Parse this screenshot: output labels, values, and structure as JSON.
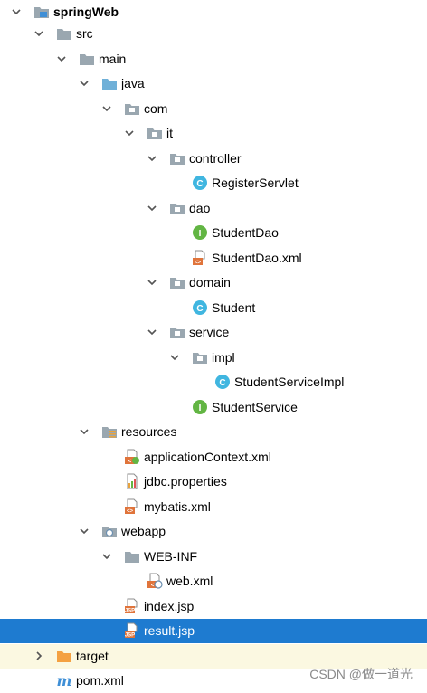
{
  "tree": [
    {
      "label": "springWeb",
      "icon": "module-folder-icon",
      "arrow": "down",
      "bold": true
    },
    {
      "label": "src",
      "icon": "folder-icon",
      "arrow": "down"
    },
    {
      "label": "main",
      "icon": "folder-icon",
      "arrow": "down"
    },
    {
      "label": "java",
      "icon": "source-root-folder-icon",
      "arrow": "down"
    },
    {
      "label": "com",
      "icon": "package-icon",
      "arrow": "down"
    },
    {
      "label": "it",
      "icon": "package-icon",
      "arrow": "down"
    },
    {
      "label": "controller",
      "icon": "package-icon",
      "arrow": "down"
    },
    {
      "label": "RegisterServlet",
      "icon": "java-class-icon",
      "arrow": "none"
    },
    {
      "label": "dao",
      "icon": "package-icon",
      "arrow": "down"
    },
    {
      "label": "StudentDao",
      "icon": "java-interface-icon",
      "arrow": "none"
    },
    {
      "label": "StudentDao.xml",
      "icon": "xml-file-icon",
      "arrow": "none"
    },
    {
      "label": "domain",
      "icon": "package-icon",
      "arrow": "down"
    },
    {
      "label": "Student",
      "icon": "java-class-icon",
      "arrow": "none"
    },
    {
      "label": "service",
      "icon": "package-icon",
      "arrow": "down"
    },
    {
      "label": "impl",
      "icon": "package-icon",
      "arrow": "down"
    },
    {
      "label": "StudentServiceImpl",
      "icon": "java-class-icon",
      "arrow": "none"
    },
    {
      "label": "StudentService",
      "icon": "java-interface-icon",
      "arrow": "none"
    },
    {
      "label": "resources",
      "icon": "resources-folder-icon",
      "arrow": "down"
    },
    {
      "label": "applicationContext.xml",
      "icon": "spring-xml-icon",
      "arrow": "none"
    },
    {
      "label": "jdbc.properties",
      "icon": "properties-file-icon",
      "arrow": "none"
    },
    {
      "label": "mybatis.xml",
      "icon": "xml-file-icon",
      "arrow": "none"
    },
    {
      "label": "webapp",
      "icon": "web-folder-icon",
      "arrow": "down"
    },
    {
      "label": "WEB-INF",
      "icon": "folder-icon",
      "arrow": "down"
    },
    {
      "label": "web.xml",
      "icon": "web-xml-icon",
      "arrow": "none"
    },
    {
      "label": "index.jsp",
      "icon": "jsp-file-icon",
      "arrow": "none"
    },
    {
      "label": "result.jsp",
      "icon": "jsp-file-icon",
      "arrow": "none",
      "selected": true
    },
    {
      "label": "target",
      "icon": "excluded-folder-icon",
      "arrow": "right",
      "highlight": true
    },
    {
      "label": "pom.xml",
      "icon": "maven-pom-icon",
      "arrow": "none"
    }
  ],
  "watermark": "CSDN @做一道光",
  "colors": {
    "selection": "#1e7bd0",
    "excluded_bg": "#fbf8e1",
    "folder": "#9aa7b0",
    "source_root": "#6fb0d8",
    "class": "#40b6e0",
    "interface": "#62b543",
    "xml": "#e0743b",
    "target": "#f4a142",
    "maven": "#3f8fd6"
  }
}
